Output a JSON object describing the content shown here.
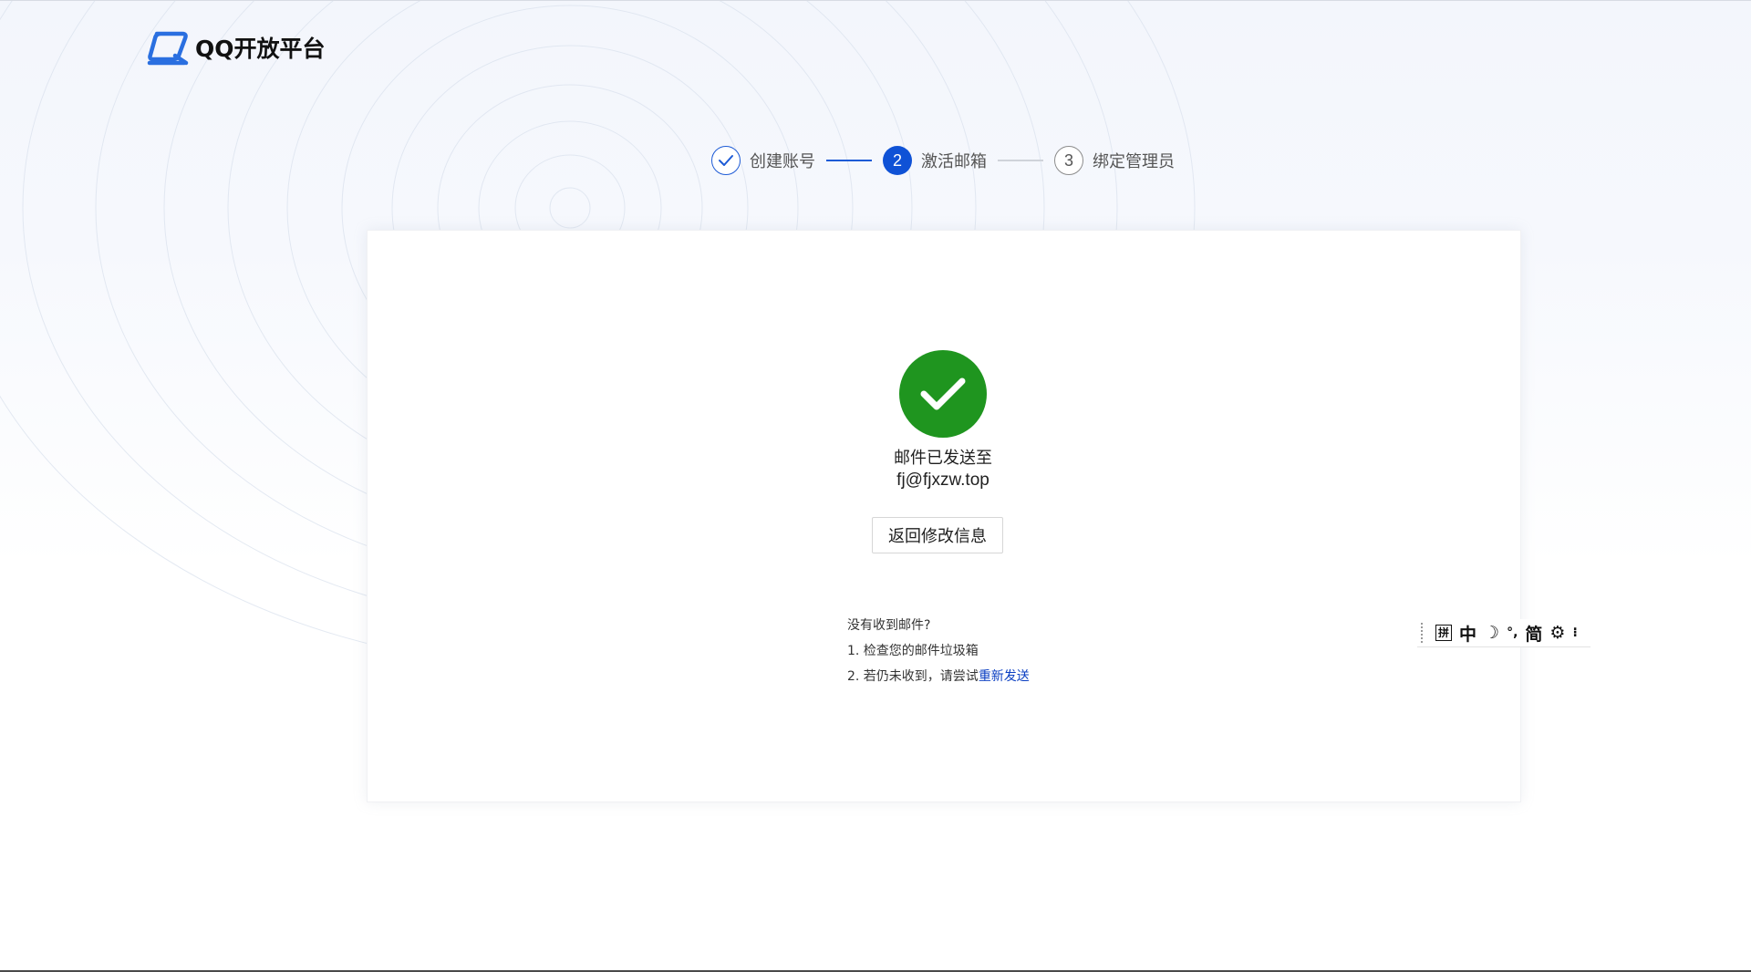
{
  "brand": {
    "logo_text": "QQ开放平台"
  },
  "steps": [
    {
      "number": "1",
      "label": "创建账号",
      "state": "done"
    },
    {
      "number": "2",
      "label": "激活邮箱",
      "state": "active"
    },
    {
      "number": "3",
      "label": "绑定管理员",
      "state": "pending"
    }
  ],
  "status": {
    "sent_label": "邮件已发送至",
    "email": "fj@fjxzw.top"
  },
  "actions": {
    "back_label": "返回修改信息"
  },
  "help": {
    "title": "没有收到邮件?",
    "tip1": "1. 检查您的邮件垃圾箱",
    "tip2_prefix": "2. 若仍未收到，请尝试",
    "resend_label": "重新发送"
  },
  "ime": {
    "pinyin": "拼",
    "chinese": "中",
    "moon": "☽",
    "punct": "°,",
    "simplified": "简",
    "settings": "⚙",
    "more": "⁝"
  },
  "colors": {
    "primary": "#0f52d6",
    "success": "#1f951f",
    "link": "#0b3fc2"
  }
}
